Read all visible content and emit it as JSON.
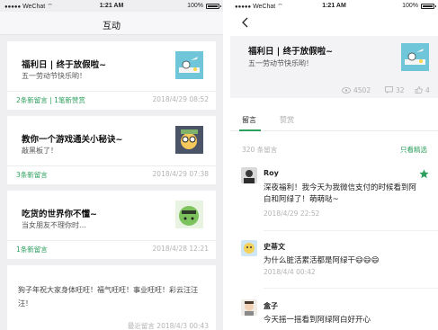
{
  "status_bar": {
    "carrier": "WeChat",
    "time": "1:21 AM",
    "battery": "100%"
  },
  "left_screen": {
    "title": "互动",
    "cards": [
      {
        "title": "福利日 | 终于放假啦~",
        "subtitle": "五一劳动节快乐哟！",
        "stats": "2条新留言 | 1笔新赞赏",
        "date": "2018/4/29 08:52",
        "thumb_icon": "chick-watering-thumbnail"
      },
      {
        "title": "教你一个游戏通关小秘诀~",
        "subtitle": "敲黑板了！",
        "stats": "3条新留言",
        "date": "2018/4/29 07:38",
        "thumb_icon": "glasses-character-thumbnail"
      },
      {
        "title": "吃货的世界你不懂~",
        "subtitle": "当女朋友不理你时…",
        "stats": "1条新留言",
        "date": "2018/4/28 12:21",
        "thumb_icon": "green-dog-thumbnail"
      }
    ],
    "message_card": {
      "text": "狗子年祝大家身体旺旺！福气旺旺！事业旺旺！彩云汪汪汪！",
      "date": "最近留言 2018/4/3 00:43"
    }
  },
  "right_screen": {
    "article": {
      "title": "福利日 | 终于放假啦~",
      "subtitle": "五一劳动节快乐哟！",
      "reads": "4502",
      "comments": "32",
      "likes": "4"
    },
    "tabs": [
      "留言",
      "赞赏"
    ],
    "comment_count": "320 条留言",
    "featured_only": "只看精选",
    "comments": [
      {
        "name": "Roy",
        "text": "深夜福利！我今天为我微信支付的时候看到阿白和阿绿了！萌萌哒~",
        "date": "2018/4/29 22:52",
        "starred": true
      },
      {
        "name": "史蒂文",
        "text": "为什么脏活累活都是阿绿干😄😄😄",
        "date": "2018/4/4 00:42",
        "starred": false
      },
      {
        "name": "盒子",
        "text": "今天摇一摇看到阿绿阿白好开心",
        "date": "",
        "starred": false
      }
    ]
  },
  "colors": {
    "accent_green": "#2c9f5d",
    "background_gray": "#efeff2",
    "muted_text": "#b3b3b3"
  }
}
